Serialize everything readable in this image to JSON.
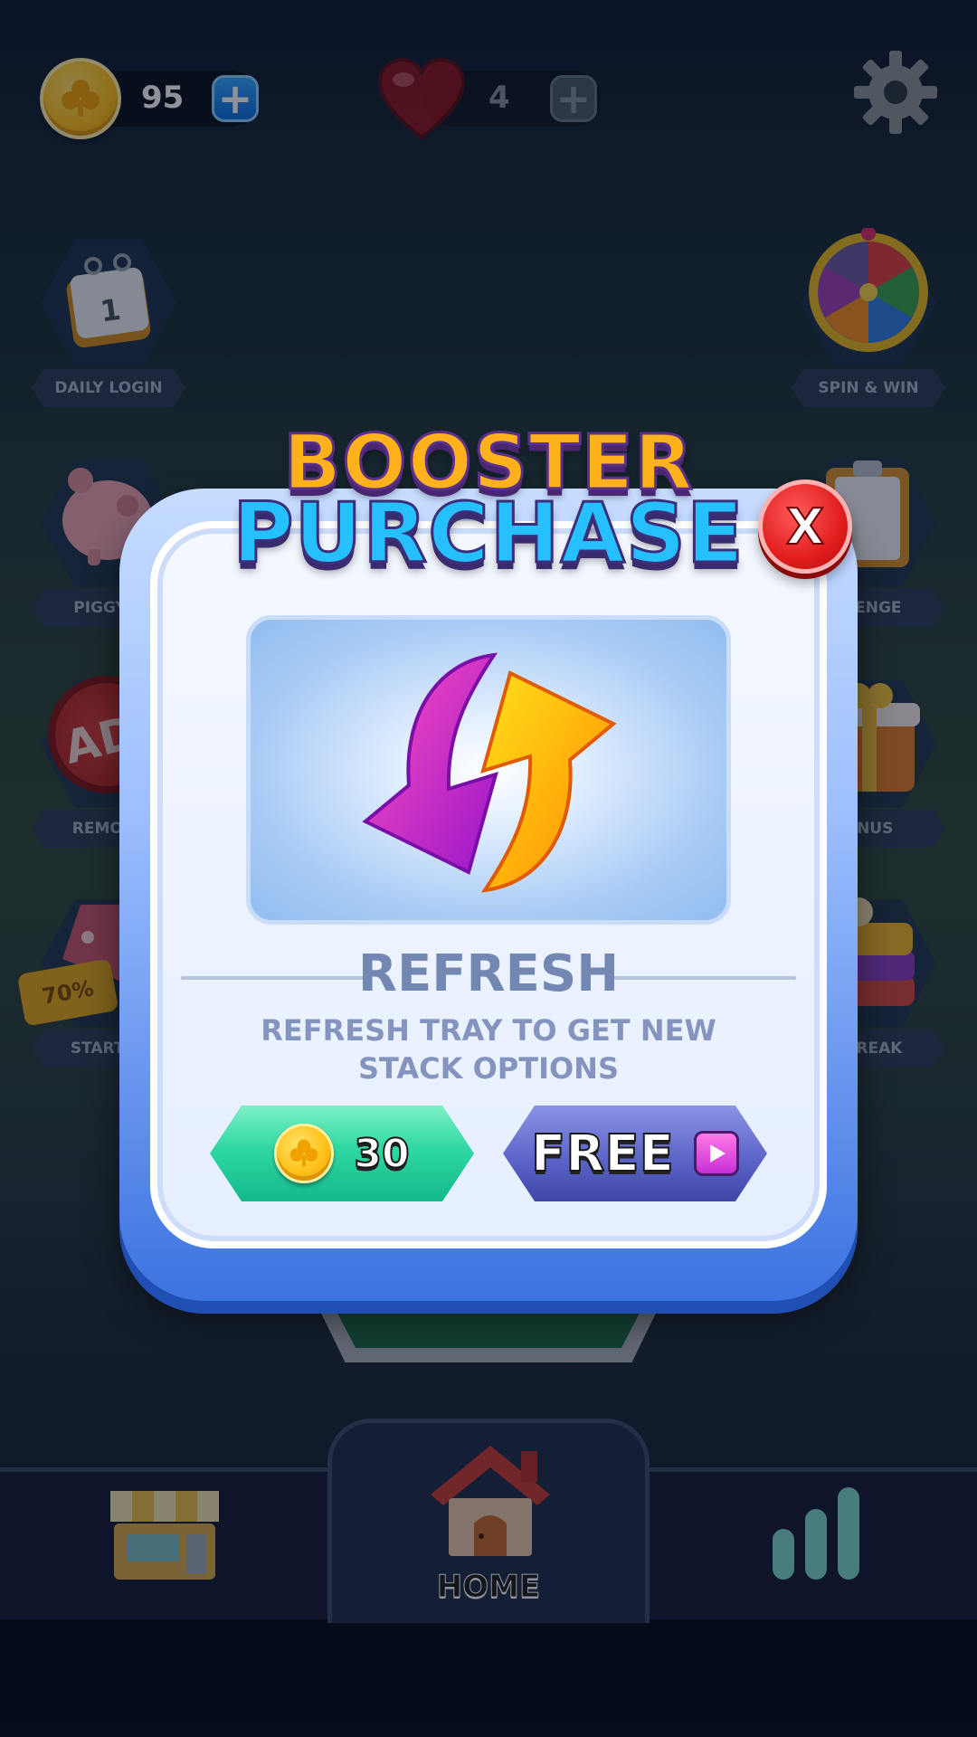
{
  "top_bar": {
    "coins": "95",
    "lives": "4"
  },
  "side_menu": {
    "left": [
      {
        "label": "DAILY LOGIN",
        "icon": "calendar-icon",
        "calendar_day": "1"
      },
      {
        "label": "PIGGY B",
        "icon": "piggy-bank-icon"
      },
      {
        "label": "REMOVE",
        "icon": "remove-ads-icon",
        "badge": "AD"
      },
      {
        "label": "STARTER",
        "icon": "starter-pack-icon",
        "badge": "70%"
      }
    ],
    "right": [
      {
        "label": "SPIN & WIN",
        "icon": "prize-wheel-icon"
      },
      {
        "label": "LLENGE",
        "icon": "clipboard-icon"
      },
      {
        "label": "ONUS",
        "icon": "gift-box-icon"
      },
      {
        "label": "STREAK",
        "icon": "cake-stack-icon"
      }
    ]
  },
  "modal": {
    "title_line1": "BOOSTER",
    "title_line2": "PURCHASE",
    "close_label": "X",
    "booster_name": "REFRESH",
    "booster_description": "REFRESH TRAY TO GET NEW STACK OPTIONS",
    "booster_icon": "refresh-arrows-icon",
    "price_coins": "30",
    "free_label": "FREE"
  },
  "bottom_nav": {
    "shop_icon": "shop-icon",
    "home_label": "HOME",
    "stats_icon": "leaderboard-icon"
  },
  "colors": {
    "coin_button": "#2fd8a4",
    "free_button": "#5c66c8",
    "close_button": "#e11e1e",
    "title_booster": "#ffb21c",
    "title_purchase": "#27c0ff"
  }
}
